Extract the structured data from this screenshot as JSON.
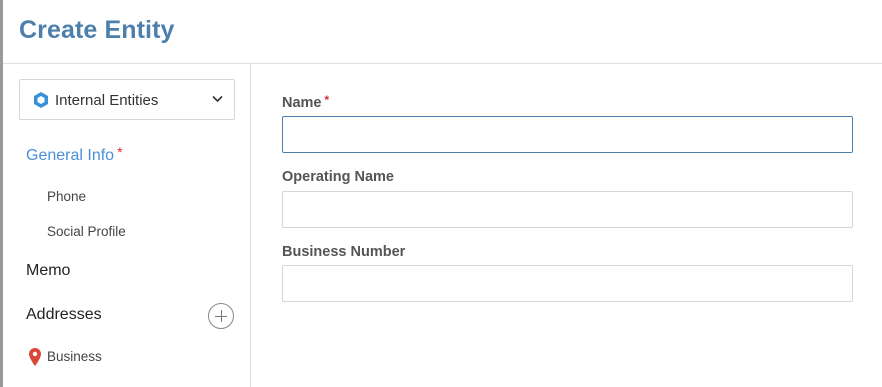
{
  "header": {
    "title": "Create Entity"
  },
  "sidebar": {
    "entity_select": {
      "value": "Internal Entities",
      "icon": "hexagon-icon",
      "color": "#3a8fd9"
    },
    "nav": {
      "general_info": "General Info",
      "general_info_required": "*",
      "phone": "Phone",
      "social_profile": "Social Profile",
      "memo": "Memo",
      "addresses": "Addresses",
      "business": "Business"
    }
  },
  "form": {
    "name": {
      "label": "Name",
      "required": "*",
      "value": "",
      "placeholder": ""
    },
    "operating_name": {
      "label": "Operating Name",
      "value": "",
      "placeholder": ""
    },
    "business_number": {
      "label": "Business Number",
      "value": "",
      "placeholder": ""
    }
  },
  "colors": {
    "title": "#4d7fad",
    "active_nav": "#4a90d9",
    "required": "#e0293a",
    "focus_border": "#4f7fa8",
    "pin": "#d9463a"
  }
}
